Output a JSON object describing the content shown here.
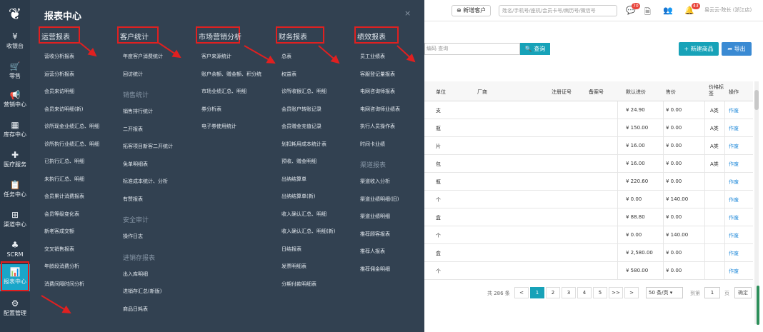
{
  "sidebar": {
    "items": [
      {
        "icon": "¥",
        "label": "收银台"
      },
      {
        "icon": "🛒",
        "label": "零售"
      },
      {
        "icon": "📢",
        "label": "营销中心"
      },
      {
        "icon": "▦",
        "label": "库存中心"
      },
      {
        "icon": "✚",
        "label": "医疗服务"
      },
      {
        "icon": "📋",
        "label": "任务中心"
      },
      {
        "icon": "⊞",
        "label": "渠道中心"
      },
      {
        "icon": "♣",
        "label": "SCRM"
      },
      {
        "icon": "📊",
        "label": "报表中心"
      },
      {
        "icon": "⚙",
        "label": "配置管理"
      }
    ]
  },
  "panel": {
    "title": "报表中心",
    "close": "×",
    "columns": [
      {
        "heading": "运营报表",
        "groups": [
          {
            "sub": "",
            "items": [
              "营收分析报表",
              "运营分析报表",
              "会员来访明细",
              "会员来访明细(新)",
              "诊所现金业绩汇总、明细",
              "诊所执行业绩汇总、明细",
              "已执行汇总、明细",
              "未执行汇总、明细",
              "会员累计消费报表",
              "会员等级变化表",
              "新老客成交额",
              "交叉销售报表",
              "年龄段消费分析",
              "消费间隔时间分析"
            ]
          }
        ]
      },
      {
        "heading": "客户统计",
        "groups": [
          {
            "sub": "",
            "items": [
              "年度客户消费统计",
              "回访统计"
            ]
          },
          {
            "sub": "销售统计",
            "items": [
              "销售排行统计",
              "二开报表",
              "拓客项目新客二开统计",
              "免单明细表",
              "标准成本统计、分析",
              "有赞报表"
            ]
          },
          {
            "sub": "安全审计",
            "items": [
              "操作日志"
            ]
          },
          {
            "sub": "进销存报表",
            "items": [
              "出入库明细",
              "进销存汇总(新版)",
              "商品日耗表"
            ]
          }
        ]
      },
      {
        "heading": "市场营销分析",
        "groups": [
          {
            "sub": "",
            "items": [
              "客户来源统计",
              "账户余额、赠金额、积分统",
              "市场业绩汇总、明细",
              "券分析表",
              "电子券使用统计"
            ]
          }
        ]
      },
      {
        "heading": "财务报表",
        "groups": [
          {
            "sub": "",
            "items": [
              "总表",
              "权益表",
              "诊所收银汇总、明细",
              "会员账户转账记录",
              "会员赠金充值记录",
              "划扣耗用成本统计表",
              "预收、赠金明细",
              "出纳结算单",
              "出纳结算单(新)",
              "收入确认汇总、明细",
              "收入确认汇总、明细(新)",
              "日结报表",
              "发票明细表",
              "分期付款明细表"
            ]
          }
        ]
      },
      {
        "heading": "绩效报表",
        "groups": [
          {
            "sub": "",
            "items": [
              "员工业绩表",
              "客服登记量报表",
              "电网咨询师报表",
              "电网咨询师业绩表",
              "执行人员操作表",
              "时间卡业绩"
            ]
          },
          {
            "sub": "渠道报表",
            "items": [
              "渠道收入分析",
              "渠道业绩明细(旧)",
              "渠道业绩明细",
              "推荐顾客报表",
              "推荐人报表",
              "推荐佣金明细"
            ]
          }
        ]
      }
    ]
  },
  "topbar": {
    "add_customer": "新增客户",
    "search_placeholder": "姓名/手机号/座机/会员卡号/病历号/微信号",
    "badges": [
      "70",
      "43"
    ],
    "user": "易云云-院长 (浙江店)"
  },
  "toolbar": {
    "search_hint": "编码 查询",
    "query": "查询",
    "new_product": "新建商品",
    "export": "导出"
  },
  "table": {
    "headers": [
      "单位",
      "厂商",
      "注册证号",
      "备案号",
      "默认进价",
      "售价",
      "价格标签",
      "操作"
    ],
    "rows": [
      {
        "unit": "支",
        "cost": "¥ 24.90",
        "price": "¥ 0.00",
        "tag": "A类",
        "op": "作废"
      },
      {
        "unit": "瓶",
        "cost": "¥ 150.00",
        "price": "¥ 0.00",
        "tag": "A类",
        "op": "作废"
      },
      {
        "unit": "片",
        "cost": "¥ 16.00",
        "price": "¥ 0.00",
        "tag": "A类",
        "op": "作废"
      },
      {
        "unit": "包",
        "cost": "¥ 16.00",
        "price": "¥ 0.00",
        "tag": "A类",
        "op": "作废"
      },
      {
        "unit": "瓶",
        "cost": "¥ 220.60",
        "price": "¥ 0.00",
        "tag": "",
        "op": "作废"
      },
      {
        "unit": "个",
        "cost": "¥ 0.00",
        "price": "¥ 140.00",
        "tag": "",
        "op": "作废"
      },
      {
        "unit": "盒",
        "cost": "¥ 88.80",
        "price": "¥ 0.00",
        "tag": "",
        "op": "作废"
      },
      {
        "unit": "个",
        "cost": "¥ 0.00",
        "price": "¥ 140.00",
        "tag": "",
        "op": "作废"
      },
      {
        "unit": "盒",
        "cost": "¥ 2,580.00",
        "price": "¥ 0.00",
        "tag": "",
        "op": "作废"
      },
      {
        "unit": "个",
        "cost": "¥ 580.00",
        "price": "¥ 0.00",
        "tag": "",
        "op": "作废"
      }
    ]
  },
  "pagination": {
    "total": "共 286 条",
    "pages": [
      "<",
      "1",
      "2",
      "3",
      "4",
      "5",
      ">>",
      ">"
    ],
    "current": "1",
    "page_size": "50 条/页",
    "goto_label": "到第",
    "goto_value": "1",
    "page_unit": "页",
    "confirm": "确定"
  }
}
